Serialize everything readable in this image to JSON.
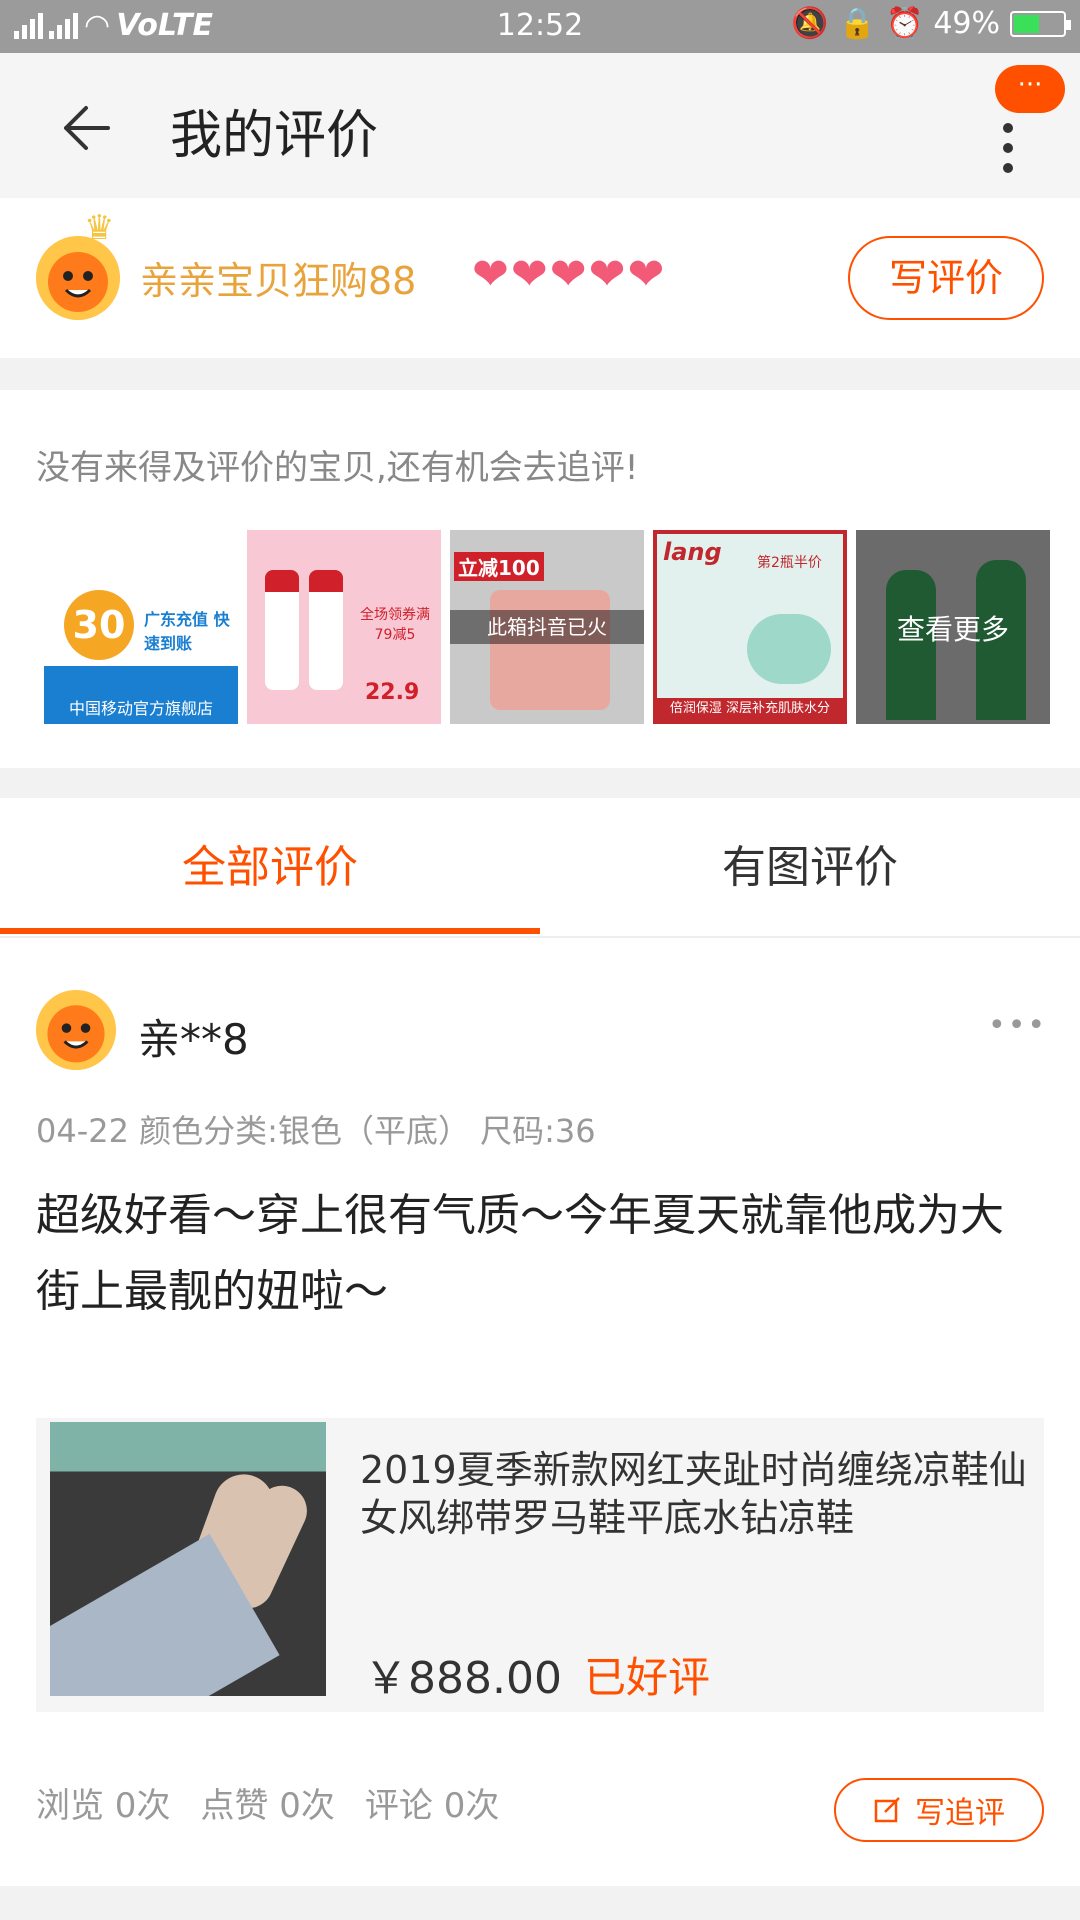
{
  "status_bar": {
    "network": "VoLTE",
    "time": "12:52",
    "battery": "49%"
  },
  "header": {
    "title": "我的评价",
    "more_label": "···"
  },
  "user": {
    "name": "亲亲宝贝狂购88",
    "hearts": [
      "❤",
      "❤",
      "❤",
      "❤",
      "❤"
    ],
    "write_review_label": "写评价"
  },
  "pending": {
    "prompt": "没有来得及评价的宝贝,还有机会去追评!",
    "items": [
      {
        "name": "china-mobile",
        "label": "中国移动官方旗舰店",
        "badge": "30",
        "sub": "广东充值 快速到账"
      },
      {
        "name": "sod-lotion",
        "label": "全场领券满79减5",
        "price": "22.9"
      },
      {
        "name": "suitcase",
        "tag": "立减100",
        "label": "此箱抖音已火"
      },
      {
        "name": "cream",
        "brand": "lang",
        "tag": "第2瓶半价",
        "label": "倍润保湿  深层补充肌肤水分"
      },
      {
        "name": "more",
        "label": "查看更多"
      }
    ]
  },
  "tabs": [
    {
      "label": "全部评价",
      "active": true
    },
    {
      "label": "有图评价",
      "active": false
    }
  ],
  "review": {
    "username": "亲**8",
    "meta": "04-22  颜色分类:银色（平底） 尺码:36",
    "text": "超级好看～穿上很有气质～今年夏天就靠他成为大街上最靓的妞啦～",
    "product": {
      "title": "2019夏季新款网红夹趾时尚缠绕凉鞋仙女风绑带罗马鞋平底水钻凉鞋",
      "price": "￥888.00",
      "status": "已好评"
    },
    "stats": [
      "浏览 0次",
      "点赞 0次",
      "评论 0次"
    ],
    "follow_label": "写追评"
  },
  "colors": {
    "accent": "#ff5000",
    "gold": "#e8a33b",
    "heart": "#f25a78"
  }
}
